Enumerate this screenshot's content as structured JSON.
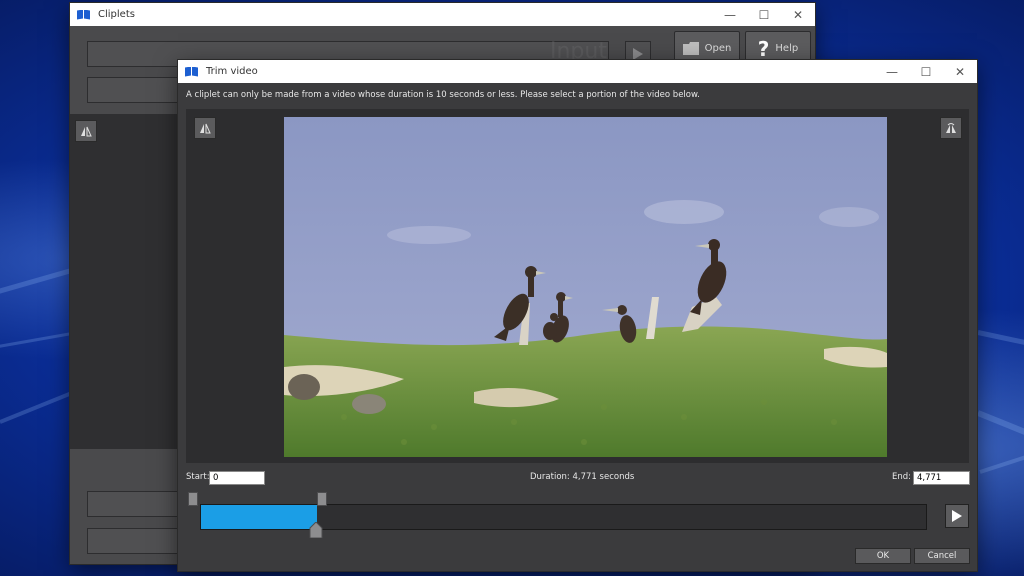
{
  "main_window": {
    "title": "Cliplets",
    "input_ghost": "Input",
    "open_label": "Open",
    "help_label": "Help"
  },
  "trim_window": {
    "title": "Trim video",
    "instruction": "A cliplet can only be made from a video whose duration is 10 seconds or less. Please select a portion of the video below.",
    "start_label": "Start:",
    "start_value": "0",
    "duration_label": "Duration:",
    "duration_value": "4,771 seconds",
    "end_label": "End:",
    "end_value": "4,771",
    "ok_label": "OK",
    "cancel_label": "Cancel",
    "selection_fraction": 0.16
  },
  "titlebar_controls": {
    "minimize": "—",
    "maximize": "☐",
    "close": "✕"
  },
  "colors": {
    "accent": "#1b9ee6",
    "desktop": "#0a2c93"
  }
}
